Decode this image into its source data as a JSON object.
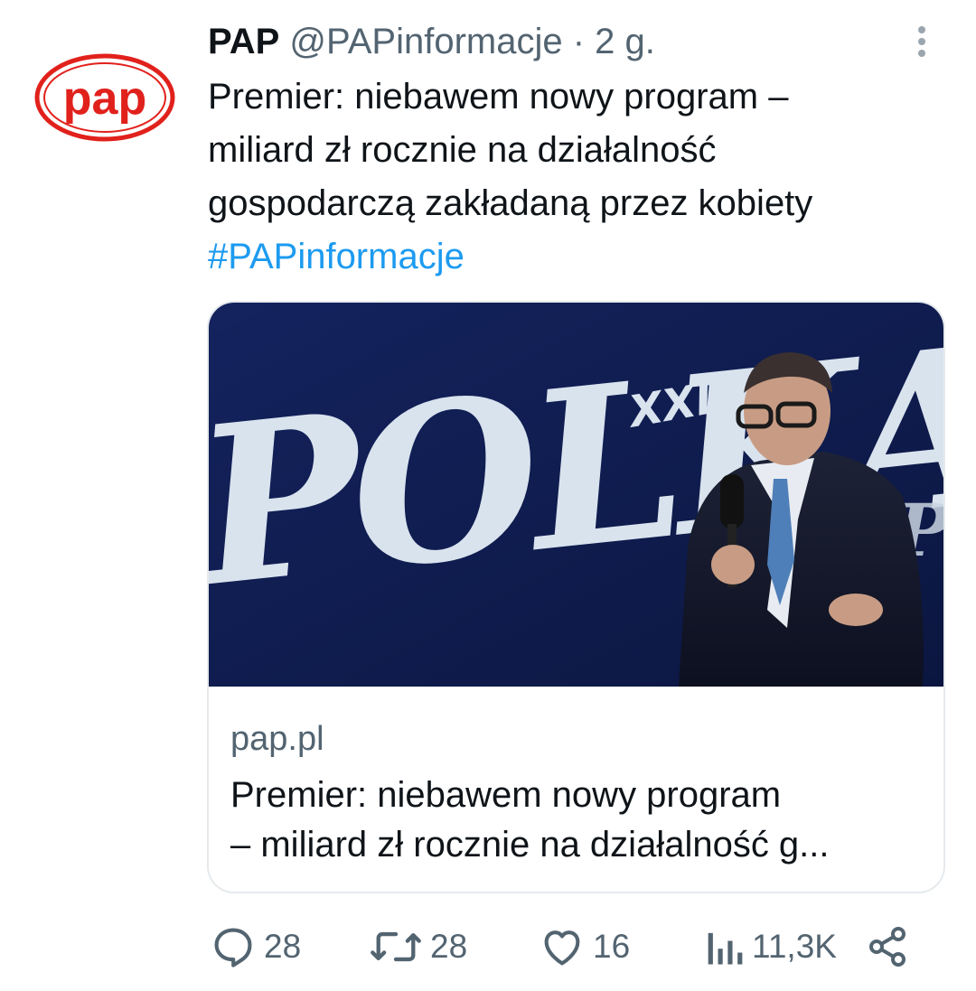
{
  "tweet": {
    "display_name": "PAP",
    "handle": "@PAPinformacje",
    "separator": "·",
    "time": "2 g.",
    "avatar_text": "pap",
    "text_lines": [
      "Premier: niebawem nowy program –",
      "miliard zł rocznie na działalność",
      "gospodarczą zakładaną przez kobiety"
    ],
    "hashtag": "#PAPinformacje"
  },
  "card": {
    "image_logo_text": "POLKA",
    "image_logo_sup": "XXI",
    "domain": "pap.pl",
    "title_lines": [
      "Premier: niebawem nowy program",
      "– miliard zł rocznie na działalność g..."
    ]
  },
  "actions": {
    "replies": "28",
    "retweets": "28",
    "likes": "16",
    "views": "11,3K"
  },
  "colors": {
    "link": "#1d9bf0",
    "muted": "#536471",
    "brand_red": "#e1211c",
    "card_bg": "#101c4a"
  },
  "icons": [
    "more-vertical-icon",
    "reply-icon",
    "retweet-icon",
    "like-icon",
    "views-icon",
    "share-icon"
  ]
}
